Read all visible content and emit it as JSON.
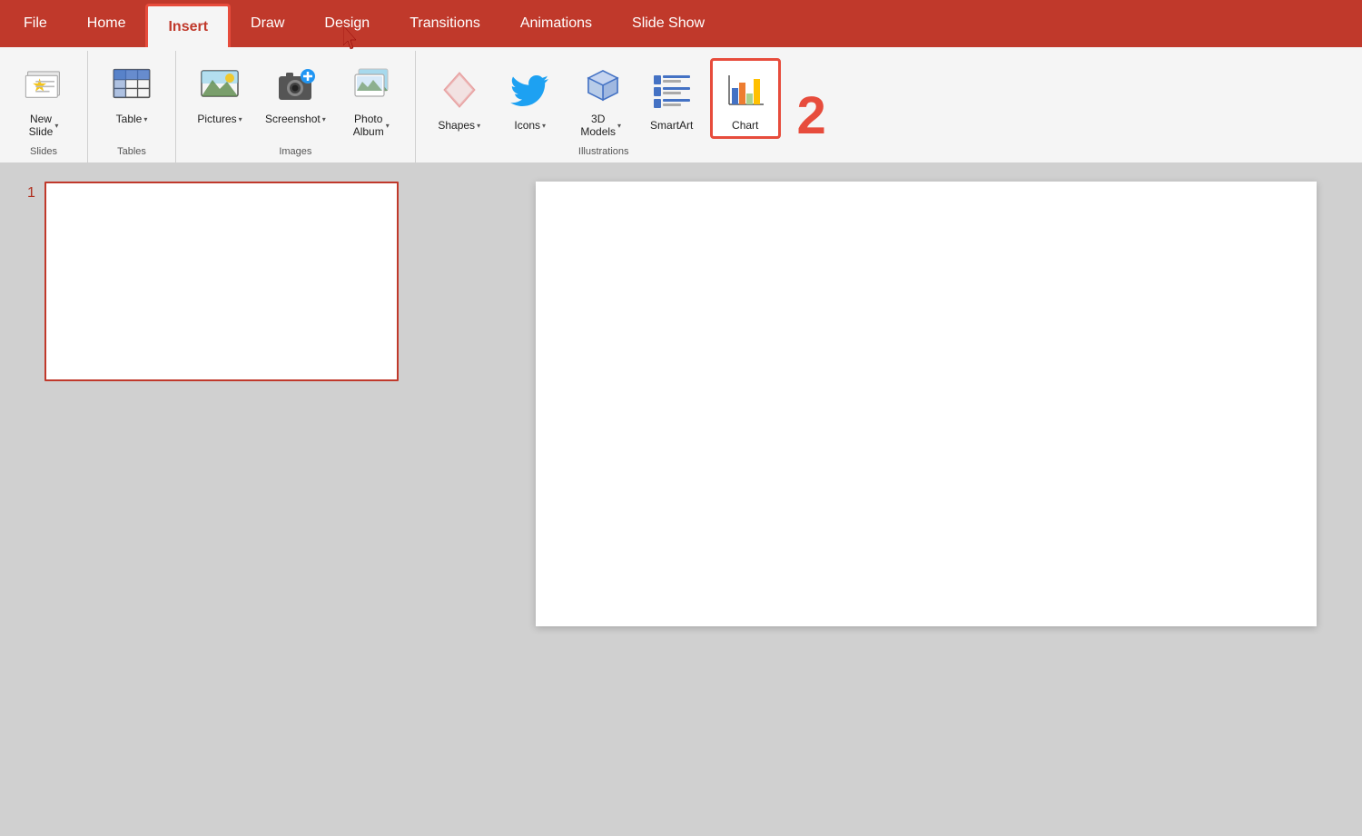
{
  "tabs": [
    {
      "id": "file",
      "label": "File",
      "active": false
    },
    {
      "id": "home",
      "label": "Home",
      "active": false
    },
    {
      "id": "insert",
      "label": "Insert",
      "active": true,
      "highlighted": true
    },
    {
      "id": "draw",
      "label": "Draw",
      "active": false
    },
    {
      "id": "design",
      "label": "Design",
      "active": false
    },
    {
      "id": "transitions",
      "label": "Transitions",
      "active": false
    },
    {
      "id": "animations",
      "label": "Animations",
      "active": false
    },
    {
      "id": "slideshow",
      "label": "Slide Show",
      "active": false
    }
  ],
  "groups": {
    "slides": {
      "label": "Slides",
      "buttons": [
        {
          "id": "new-slide",
          "label": "New\nSlide",
          "has_dropdown": true
        }
      ]
    },
    "tables": {
      "label": "Tables",
      "buttons": [
        {
          "id": "table",
          "label": "Table",
          "has_dropdown": true
        }
      ]
    },
    "images": {
      "label": "Images",
      "buttons": [
        {
          "id": "pictures",
          "label": "Pictures",
          "has_dropdown": true
        },
        {
          "id": "screenshot",
          "label": "Screenshot",
          "has_dropdown": true
        },
        {
          "id": "photo-album",
          "label": "Photo\nAlbum",
          "has_dropdown": true
        }
      ]
    },
    "illustrations": {
      "label": "Illustrations",
      "buttons": [
        {
          "id": "shapes",
          "label": "Shapes",
          "has_dropdown": true
        },
        {
          "id": "icons",
          "label": "Icons",
          "has_dropdown": true
        },
        {
          "id": "3d-models",
          "label": "3D\nModels",
          "has_dropdown": true
        },
        {
          "id": "smartart",
          "label": "SmartArt",
          "has_dropdown": false
        },
        {
          "id": "chart",
          "label": "Chart",
          "has_dropdown": false,
          "highlighted": true
        }
      ]
    }
  },
  "slide": {
    "number": "1"
  },
  "annotations": {
    "number2": "2"
  }
}
